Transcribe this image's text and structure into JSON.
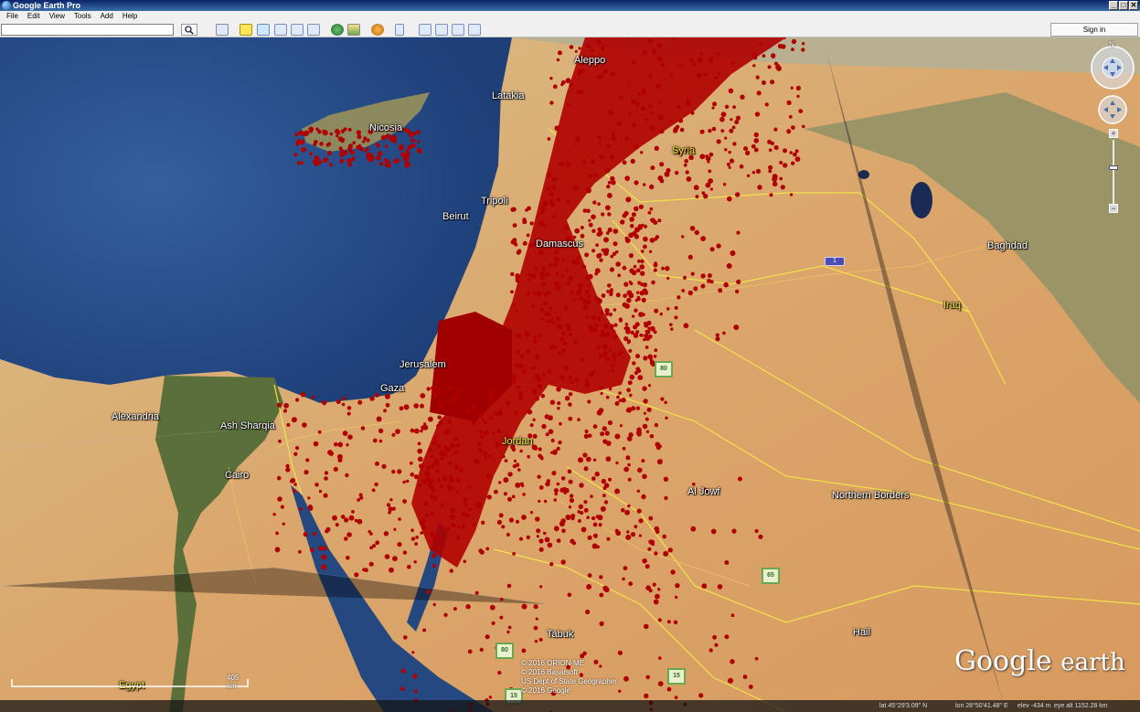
{
  "window": {
    "title": "Google Earth Pro",
    "minimize": "_",
    "maximize": "□",
    "close": "✕"
  },
  "menu": [
    "File",
    "Edit",
    "View",
    "Tools",
    "Add",
    "Help"
  ],
  "toolbar": {
    "search_value": "",
    "sign_in": "Sign in"
  },
  "map_labels": {
    "cyprus": "Nicosia",
    "syria": "Syria",
    "beirut": "Beirut",
    "damascus": "Damascus",
    "baghdad": "Baghdad",
    "iraq": "Iraq",
    "jerusalem": "Jerusalem",
    "gaza": "Gaza",
    "alexandria": "Alexandria",
    "ash_sharqia": "Ash Sharqia",
    "cairo": "Cairo",
    "jordan": "Jordan",
    "al_jowf": "Al Jowf",
    "northern_borders": "Northern Borders",
    "tabuk": "Tabuk",
    "hail": "Hail",
    "egypt": "Egypt",
    "aleppo": "Aleppo",
    "latakia": "Latakia",
    "tripoli": "Tripoli"
  },
  "shields": {
    "s1": "80",
    "s2": "65",
    "s3": "80",
    "s4": "15",
    "s5": "15",
    "hwy": "1"
  },
  "compass": {
    "north": "N"
  },
  "zoom": {
    "plus": "+",
    "minus": "−"
  },
  "credits": [
    "© 2016 ORION-ME",
    "© 2016 Basarsoft",
    "US Dept of State Geographer",
    "© 2016 Google"
  ],
  "logo": {
    "google": "Google",
    "earth": "earth"
  },
  "scale": {
    "label": "405 km"
  },
  "status": {
    "lat": "lat  45°29'3.09\" N",
    "lon": "lon  28°50'41.48\" E",
    "elev": "elev  -434 m",
    "eye": "eye alt  1152.28 km"
  },
  "colors": {
    "sea": "#2a4f8c",
    "desert": "#d9a56a",
    "points": "#b00000",
    "borders": "#f2e24a"
  }
}
